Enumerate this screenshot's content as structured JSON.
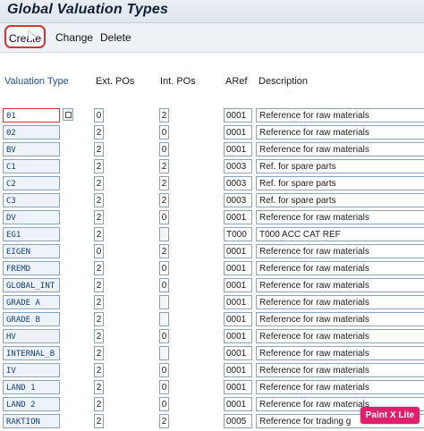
{
  "title": "Global Valuation Types",
  "toolbar": {
    "create": "Create",
    "change": "Change",
    "delete": "Delete"
  },
  "columns": {
    "valuation_type": "Valuation Type",
    "ext_pos": "Ext. POs",
    "int_pos": "Int. POs",
    "aref": "ARef",
    "description": "Description"
  },
  "rows": [
    {
      "vt": "01",
      "ext": "0",
      "int": "2",
      "aref": "0001",
      "desc": "Reference for raw materials"
    },
    {
      "vt": "02",
      "ext": "2",
      "int": "0",
      "aref": "0001",
      "desc": "Reference for raw materials"
    },
    {
      "vt": "BV",
      "ext": "2",
      "int": "0",
      "aref": "0001",
      "desc": "Reference for raw materials"
    },
    {
      "vt": "C1",
      "ext": "2",
      "int": "2",
      "aref": "0003",
      "desc": "Ref. for spare parts"
    },
    {
      "vt": "C2",
      "ext": "2",
      "int": "2",
      "aref": "0003",
      "desc": "Ref. for spare parts"
    },
    {
      "vt": "C3",
      "ext": "2",
      "int": "2",
      "aref": "0003",
      "desc": "Ref. for spare parts"
    },
    {
      "vt": "DV",
      "ext": "2",
      "int": "0",
      "aref": "0001",
      "desc": "Reference for raw materials"
    },
    {
      "vt": "EG1",
      "ext": "2",
      "int": "",
      "aref": "T000",
      "desc": "T000 ACC CAT REF"
    },
    {
      "vt": "EIGEN",
      "ext": "0",
      "int": "2",
      "aref": "0001",
      "desc": "Reference for raw materials"
    },
    {
      "vt": "FREMD",
      "ext": "2",
      "int": "0",
      "aref": "0001",
      "desc": "Reference for raw materials"
    },
    {
      "vt": "GLOBAL_INT",
      "ext": "2",
      "int": "0",
      "aref": "0001",
      "desc": "Reference for raw materials"
    },
    {
      "vt": "GRADE A",
      "ext": "2",
      "int": "",
      "aref": "0001",
      "desc": "Reference for raw materials"
    },
    {
      "vt": "GRADE B",
      "ext": "2",
      "int": "",
      "aref": "0001",
      "desc": "Reference for raw materials"
    },
    {
      "vt": "HV",
      "ext": "2",
      "int": "0",
      "aref": "0001",
      "desc": "Reference for raw materials"
    },
    {
      "vt": "INTERNAL_B",
      "ext": "2",
      "int": "",
      "aref": "0001",
      "desc": "Reference for raw materials"
    },
    {
      "vt": "IV",
      "ext": "2",
      "int": "0",
      "aref": "0001",
      "desc": "Reference for raw materials"
    },
    {
      "vt": "LAND 1",
      "ext": "2",
      "int": "0",
      "aref": "0001",
      "desc": "Reference for raw materials"
    },
    {
      "vt": "LAND 2",
      "ext": "2",
      "int": "0",
      "aref": "0001",
      "desc": "Reference for raw materials"
    },
    {
      "vt": "RAKTION",
      "ext": "2",
      "int": "2",
      "aref": "0005",
      "desc": "Reference for trading g"
    }
  ],
  "watermark": "Paint X Lite",
  "colors": {
    "accent": "#1f4f9e",
    "highlight": "#d9342f",
    "watermark_bg": "#e31e6a"
  }
}
